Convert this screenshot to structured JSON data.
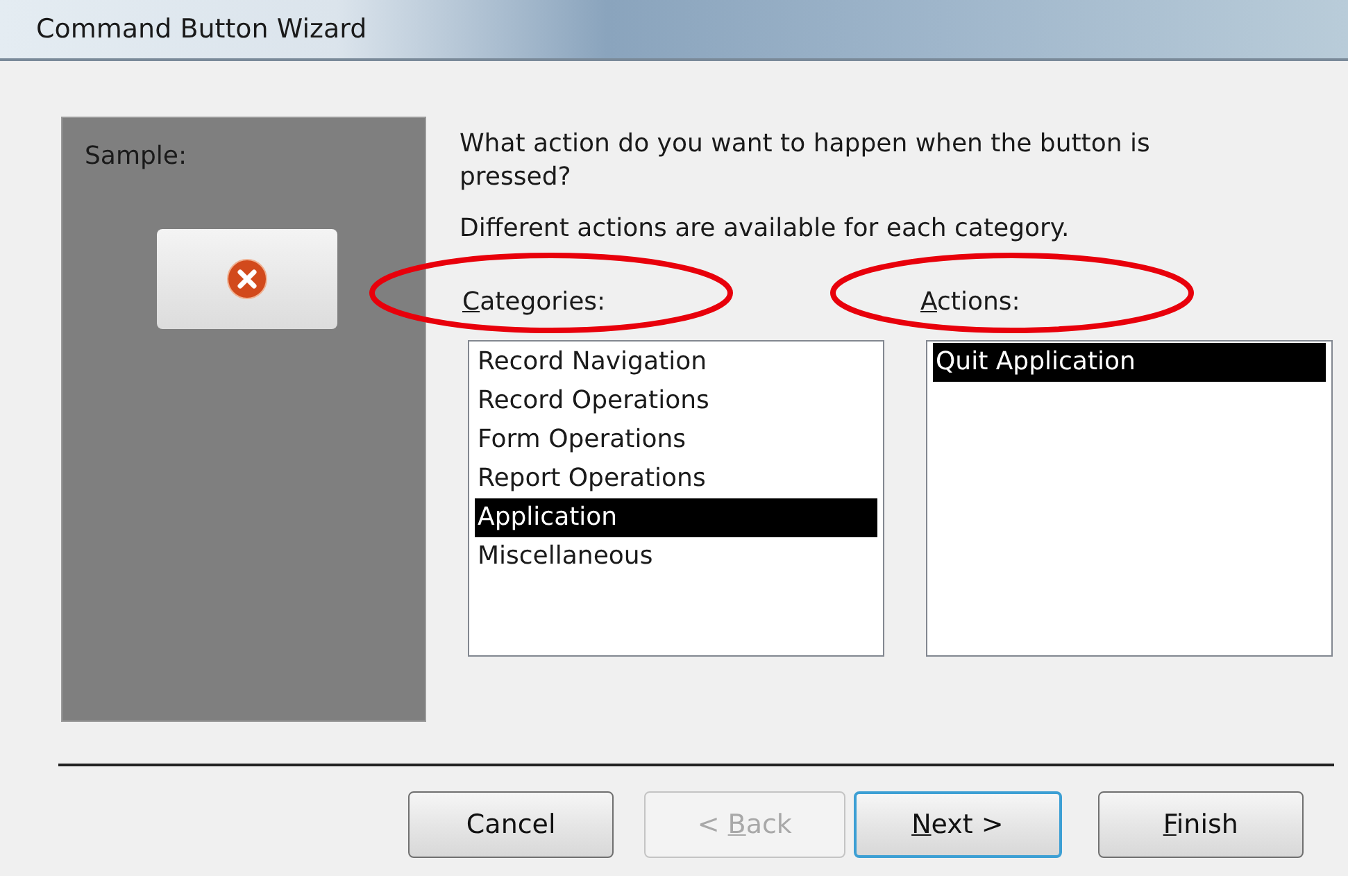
{
  "window": {
    "title": "Command Button Wizard"
  },
  "sample": {
    "label": "Sample:"
  },
  "prompt": {
    "question": "What action do you want to happen when the button is pressed?",
    "hint": "Different actions are available for each category."
  },
  "categories": {
    "label": {
      "key": "C",
      "rest": "ategories:"
    },
    "circled": true,
    "items": [
      {
        "label": "Record Navigation",
        "selected": false
      },
      {
        "label": "Record Operations",
        "selected": false
      },
      {
        "label": "Form Operations",
        "selected": false
      },
      {
        "label": "Report Operations",
        "selected": false
      },
      {
        "label": "Application",
        "selected": true
      },
      {
        "label": "Miscellaneous",
        "selected": false
      }
    ]
  },
  "actions": {
    "label": {
      "key": "A",
      "rest": "ctions:"
    },
    "circled": true,
    "items": [
      {
        "label": "Quit Application",
        "selected": true
      }
    ]
  },
  "buttons": [
    {
      "rest": "Cancel",
      "disabled": false,
      "default": false
    },
    {
      "before": "< ",
      "key": "B",
      "rest": "ack",
      "disabled": true,
      "default": false
    },
    {
      "key": "N",
      "rest": "ext >",
      "disabled": false,
      "default": true
    },
    {
      "key": "F",
      "rest": "inish",
      "disabled": false,
      "default": false
    }
  ]
}
